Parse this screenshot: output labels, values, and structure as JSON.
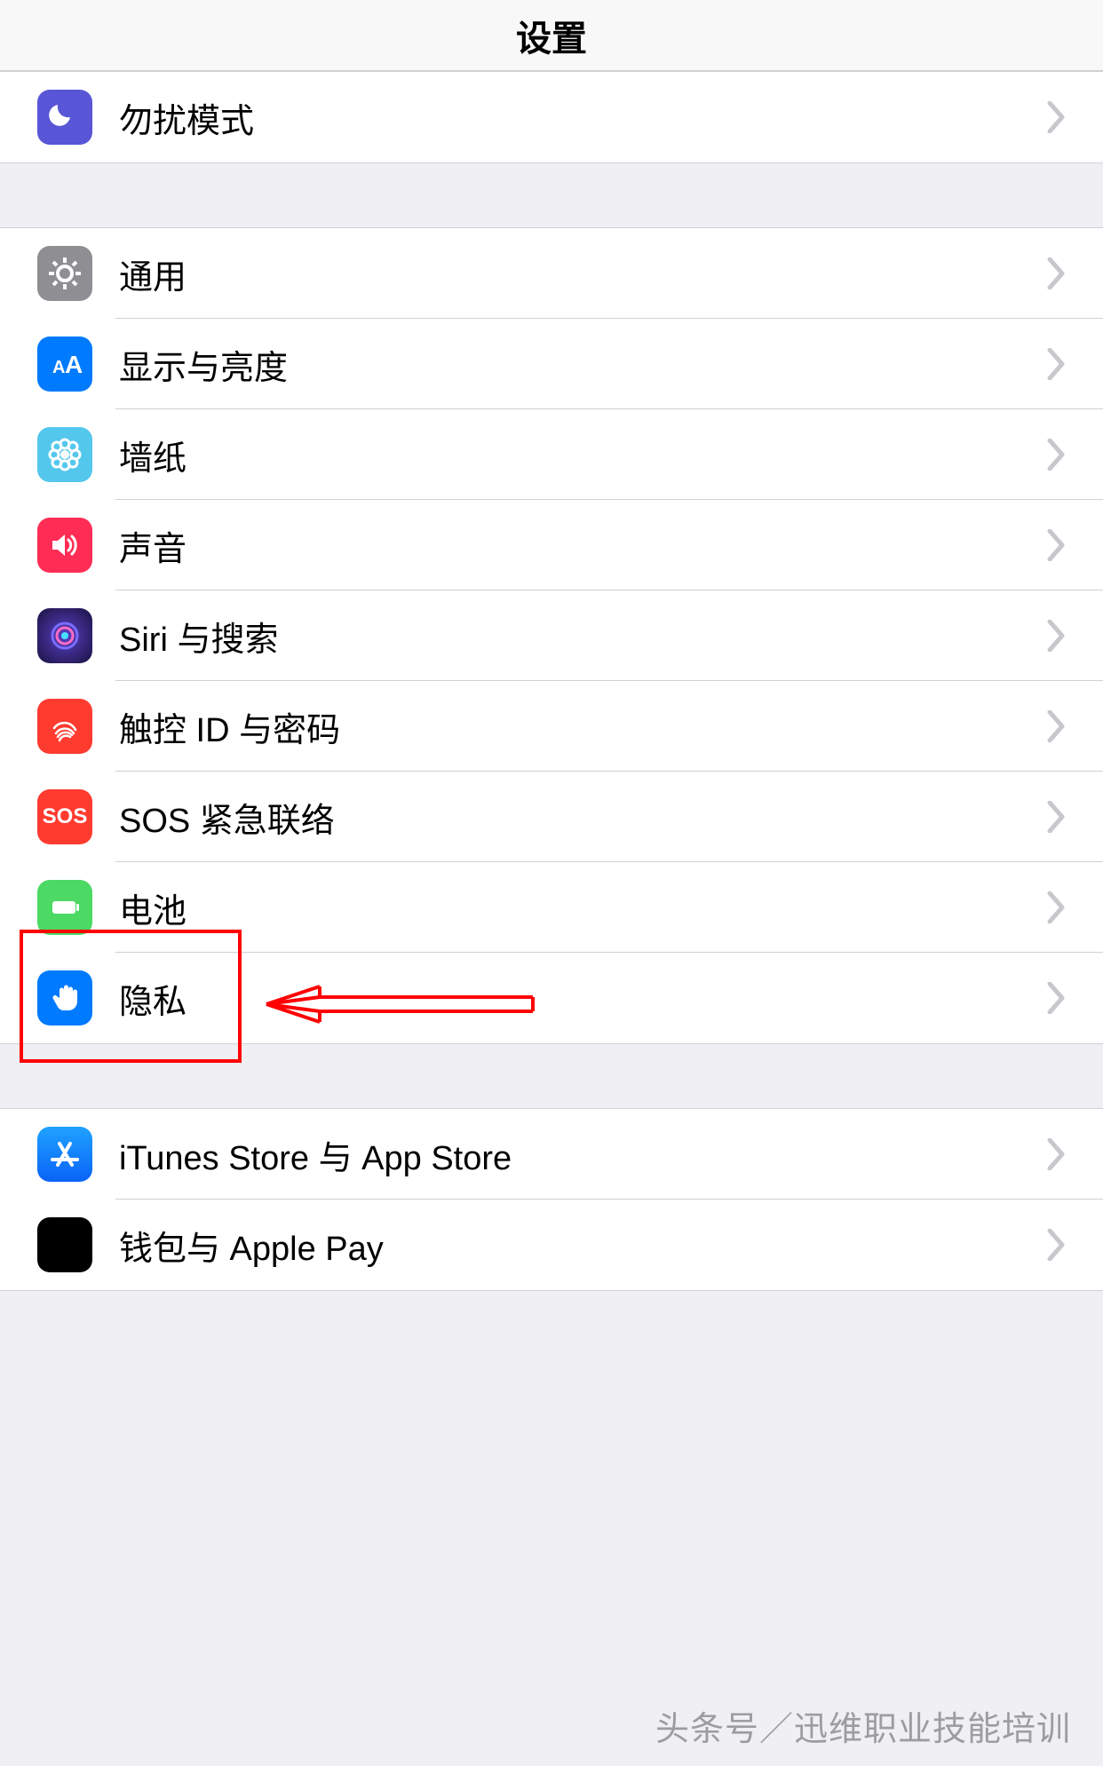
{
  "header": {
    "title": "设置"
  },
  "groups": [
    {
      "rows": [
        {
          "key": "dnd",
          "label": "勿扰模式",
          "icon": "moon-icon",
          "icon_class": "ic-dnd"
        }
      ]
    },
    {
      "rows": [
        {
          "key": "general",
          "label": "通用",
          "icon": "gear-icon",
          "icon_class": "ic-general"
        },
        {
          "key": "display",
          "label": "显示与亮度",
          "icon": "text-size-icon",
          "icon_class": "ic-display"
        },
        {
          "key": "wallpaper",
          "label": "墙纸",
          "icon": "flower-icon",
          "icon_class": "ic-wallpaper"
        },
        {
          "key": "sound",
          "label": "声音",
          "icon": "speaker-icon",
          "icon_class": "ic-sound"
        },
        {
          "key": "siri",
          "label": "Siri 与搜索",
          "icon": "siri-icon",
          "icon_class": "ic-siri"
        },
        {
          "key": "touchid",
          "label": "触控 ID 与密码",
          "icon": "fingerprint-icon",
          "icon_class": "ic-touchid"
        },
        {
          "key": "sos",
          "label": "SOS 紧急联络",
          "icon": "sos-icon",
          "icon_class": "ic-sos",
          "icon_text": "SOS"
        },
        {
          "key": "battery",
          "label": "电池",
          "icon": "battery-icon",
          "icon_class": "ic-battery"
        },
        {
          "key": "privacy",
          "label": "隐私",
          "icon": "hand-icon",
          "icon_class": "ic-privacy",
          "highlighted": true
        }
      ]
    },
    {
      "rows": [
        {
          "key": "appstore",
          "label": "iTunes Store 与 App Store",
          "icon": "appstore-icon",
          "icon_class": "ic-appstore"
        },
        {
          "key": "wallet",
          "label": "钱包与 Apple Pay",
          "icon": "wallet-icon",
          "icon_class": "ic-wallet"
        }
      ]
    }
  ],
  "watermark": "头条号／迅维职业技能培训",
  "annotation": {
    "highlight_key": "privacy",
    "arrow_color": "#ff0000"
  }
}
